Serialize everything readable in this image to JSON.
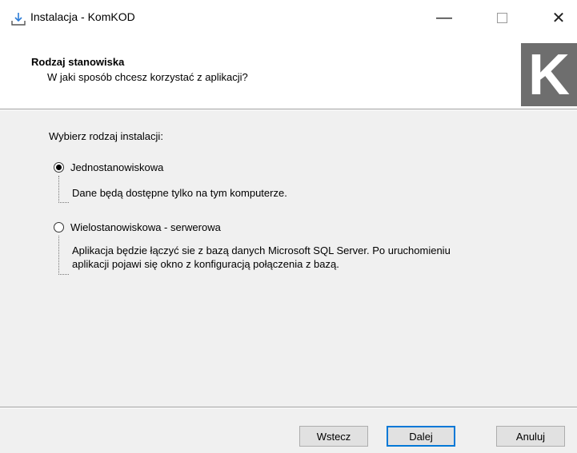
{
  "window": {
    "title": "Instalacja - KomKOD",
    "minimize_glyph": "—",
    "close_glyph": "✕"
  },
  "header": {
    "title": "Rodzaj stanowiska",
    "subtitle": "W jaki sposób chcesz korzystać z aplikacji?",
    "logo_letter": "K"
  },
  "content": {
    "prompt": "Wybierz rodzaj instalacji:",
    "options": [
      {
        "label": "Jednostanowiskowa",
        "selected": true,
        "description": "Dane będą dostępne tylko na tym komputerze."
      },
      {
        "label": "Wielostanowiskowa - serwerowa",
        "selected": false,
        "description_line1": "Aplikacja będzie łączyć sie z bazą danych Microsoft SQL Server. Po uruchomieniu",
        "description_line2": "aplikacji pojawi się okno z konfiguracją połączenia z bazą."
      }
    ]
  },
  "footer": {
    "back_label": "Wstecz",
    "next_label": "Dalej",
    "cancel_label": "Anuluj"
  },
  "colors": {
    "accent": "#0078d7",
    "logo_bg": "#6e6e6e",
    "panel_bg": "#f0f0f0"
  }
}
